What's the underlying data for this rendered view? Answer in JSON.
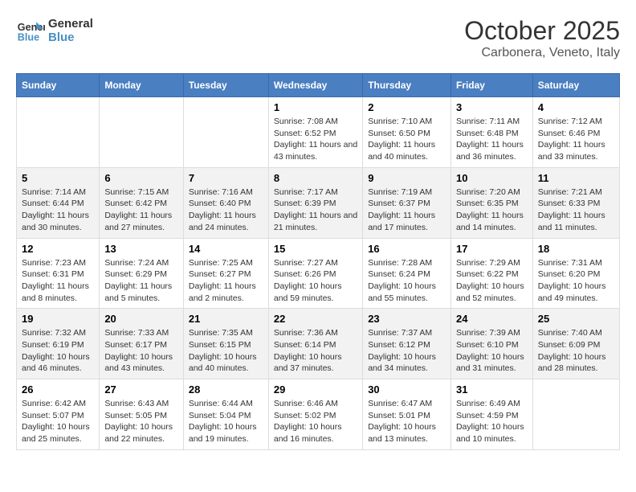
{
  "logo": {
    "line1": "General",
    "line2": "Blue"
  },
  "title": "October 2025",
  "subtitle": "Carbonera, Veneto, Italy",
  "headers": [
    "Sunday",
    "Monday",
    "Tuesday",
    "Wednesday",
    "Thursday",
    "Friday",
    "Saturday"
  ],
  "weeks": [
    [
      {
        "day": "",
        "info": ""
      },
      {
        "day": "",
        "info": ""
      },
      {
        "day": "",
        "info": ""
      },
      {
        "day": "1",
        "info": "Sunrise: 7:08 AM\nSunset: 6:52 PM\nDaylight: 11 hours and 43 minutes."
      },
      {
        "day": "2",
        "info": "Sunrise: 7:10 AM\nSunset: 6:50 PM\nDaylight: 11 hours and 40 minutes."
      },
      {
        "day": "3",
        "info": "Sunrise: 7:11 AM\nSunset: 6:48 PM\nDaylight: 11 hours and 36 minutes."
      },
      {
        "day": "4",
        "info": "Sunrise: 7:12 AM\nSunset: 6:46 PM\nDaylight: 11 hours and 33 minutes."
      }
    ],
    [
      {
        "day": "5",
        "info": "Sunrise: 7:14 AM\nSunset: 6:44 PM\nDaylight: 11 hours and 30 minutes."
      },
      {
        "day": "6",
        "info": "Sunrise: 7:15 AM\nSunset: 6:42 PM\nDaylight: 11 hours and 27 minutes."
      },
      {
        "day": "7",
        "info": "Sunrise: 7:16 AM\nSunset: 6:40 PM\nDaylight: 11 hours and 24 minutes."
      },
      {
        "day": "8",
        "info": "Sunrise: 7:17 AM\nSunset: 6:39 PM\nDaylight: 11 hours and 21 minutes."
      },
      {
        "day": "9",
        "info": "Sunrise: 7:19 AM\nSunset: 6:37 PM\nDaylight: 11 hours and 17 minutes."
      },
      {
        "day": "10",
        "info": "Sunrise: 7:20 AM\nSunset: 6:35 PM\nDaylight: 11 hours and 14 minutes."
      },
      {
        "day": "11",
        "info": "Sunrise: 7:21 AM\nSunset: 6:33 PM\nDaylight: 11 hours and 11 minutes."
      }
    ],
    [
      {
        "day": "12",
        "info": "Sunrise: 7:23 AM\nSunset: 6:31 PM\nDaylight: 11 hours and 8 minutes."
      },
      {
        "day": "13",
        "info": "Sunrise: 7:24 AM\nSunset: 6:29 PM\nDaylight: 11 hours and 5 minutes."
      },
      {
        "day": "14",
        "info": "Sunrise: 7:25 AM\nSunset: 6:27 PM\nDaylight: 11 hours and 2 minutes."
      },
      {
        "day": "15",
        "info": "Sunrise: 7:27 AM\nSunset: 6:26 PM\nDaylight: 10 hours and 59 minutes."
      },
      {
        "day": "16",
        "info": "Sunrise: 7:28 AM\nSunset: 6:24 PM\nDaylight: 10 hours and 55 minutes."
      },
      {
        "day": "17",
        "info": "Sunrise: 7:29 AM\nSunset: 6:22 PM\nDaylight: 10 hours and 52 minutes."
      },
      {
        "day": "18",
        "info": "Sunrise: 7:31 AM\nSunset: 6:20 PM\nDaylight: 10 hours and 49 minutes."
      }
    ],
    [
      {
        "day": "19",
        "info": "Sunrise: 7:32 AM\nSunset: 6:19 PM\nDaylight: 10 hours and 46 minutes."
      },
      {
        "day": "20",
        "info": "Sunrise: 7:33 AM\nSunset: 6:17 PM\nDaylight: 10 hours and 43 minutes."
      },
      {
        "day": "21",
        "info": "Sunrise: 7:35 AM\nSunset: 6:15 PM\nDaylight: 10 hours and 40 minutes."
      },
      {
        "day": "22",
        "info": "Sunrise: 7:36 AM\nSunset: 6:14 PM\nDaylight: 10 hours and 37 minutes."
      },
      {
        "day": "23",
        "info": "Sunrise: 7:37 AM\nSunset: 6:12 PM\nDaylight: 10 hours and 34 minutes."
      },
      {
        "day": "24",
        "info": "Sunrise: 7:39 AM\nSunset: 6:10 PM\nDaylight: 10 hours and 31 minutes."
      },
      {
        "day": "25",
        "info": "Sunrise: 7:40 AM\nSunset: 6:09 PM\nDaylight: 10 hours and 28 minutes."
      }
    ],
    [
      {
        "day": "26",
        "info": "Sunrise: 6:42 AM\nSunset: 5:07 PM\nDaylight: 10 hours and 25 minutes."
      },
      {
        "day": "27",
        "info": "Sunrise: 6:43 AM\nSunset: 5:05 PM\nDaylight: 10 hours and 22 minutes."
      },
      {
        "day": "28",
        "info": "Sunrise: 6:44 AM\nSunset: 5:04 PM\nDaylight: 10 hours and 19 minutes."
      },
      {
        "day": "29",
        "info": "Sunrise: 6:46 AM\nSunset: 5:02 PM\nDaylight: 10 hours and 16 minutes."
      },
      {
        "day": "30",
        "info": "Sunrise: 6:47 AM\nSunset: 5:01 PM\nDaylight: 10 hours and 13 minutes."
      },
      {
        "day": "31",
        "info": "Sunrise: 6:49 AM\nSunset: 4:59 PM\nDaylight: 10 hours and 10 minutes."
      },
      {
        "day": "",
        "info": ""
      }
    ]
  ]
}
